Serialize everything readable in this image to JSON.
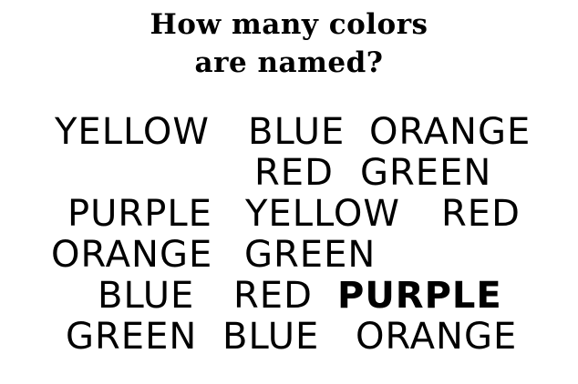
{
  "title": {
    "line1": "How many colors",
    "line2": "are named?"
  },
  "words": [
    [
      "YELLOW",
      "BLUE",
      "ORANGE"
    ],
    [
      "RED",
      "GREEN"
    ],
    [
      "PURPLE",
      "YELLOW",
      "RED"
    ],
    [
      "ORANGE",
      "GREEN"
    ],
    [
      "BLUE",
      "RED",
      "PURPLE"
    ],
    [
      "GREEN",
      "BLUE",
      "ORANGE"
    ]
  ],
  "colors": {
    "text": "#000000",
    "background": "#ffffff"
  }
}
